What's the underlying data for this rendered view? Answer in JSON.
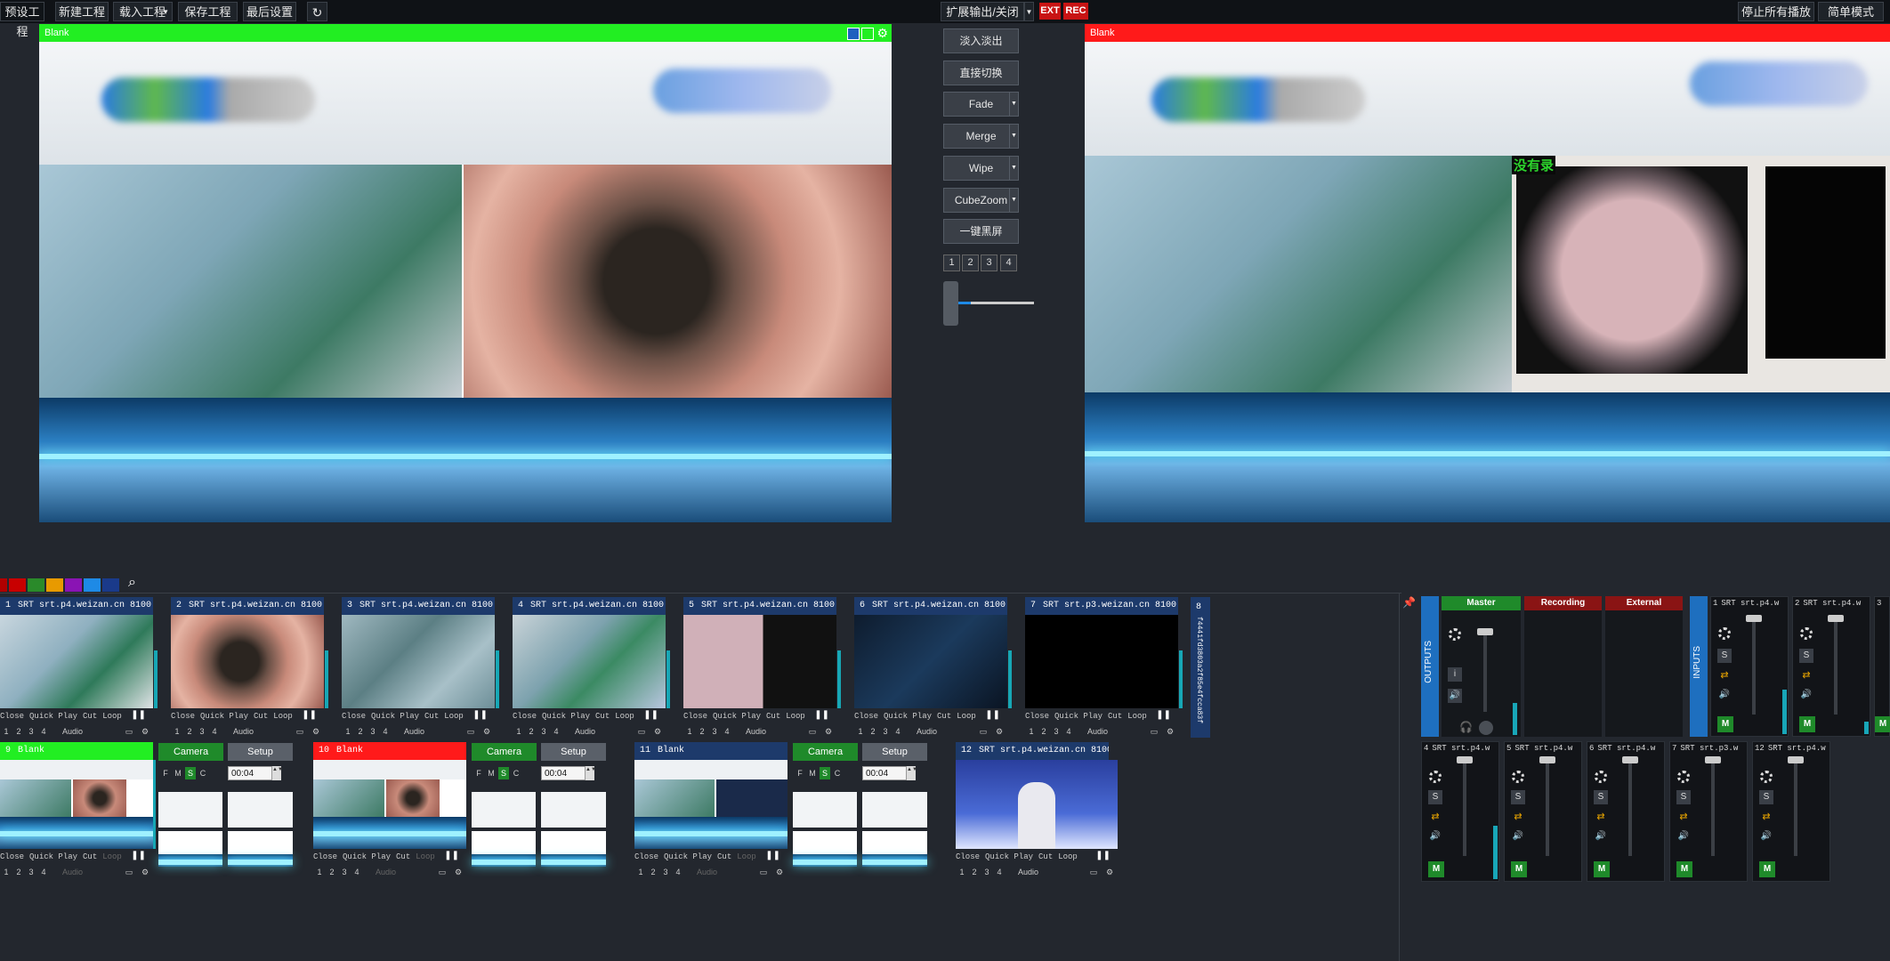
{
  "toolbar": {
    "preset": "预设工程",
    "new_project": "新建工程",
    "load_project": "载入工程",
    "save_project": "保存工程",
    "last_settings": "最后设置",
    "ext_output": "扩展输出/关闭",
    "ext": "EXT",
    "rec": "REC",
    "stop_all": "停止所有播放",
    "simple_mode": "简单模式"
  },
  "preview": {
    "title": "Blank"
  },
  "program": {
    "title": "Blank",
    "overlay_text": "没有录"
  },
  "transitions": {
    "fade_in_out": "淡入淡出",
    "direct_cut": "直接切换",
    "fade": "Fade",
    "merge": "Merge",
    "wipe": "Wipe",
    "cubezoom": "CubeZoom",
    "black_screen": "一键黑屏",
    "pages": [
      "1",
      "2",
      "3",
      "4"
    ],
    "tbar_level": 0.3
  },
  "colors": {
    "preview_bar": "#22ee22",
    "program_bar": "#ff1a1a",
    "input_title": "#1d3a6b",
    "accent_green": "#1f8a2a",
    "swatches": [
      "#c80000",
      "#2a8a2a",
      "#e89a00",
      "#8a14b4",
      "#1e8ae6",
      "#1a3a8a"
    ]
  },
  "inputs_row1": [
    {
      "num": "1",
      "title": "SRT srt.p4.weizan.cn 8100",
      "scene": "or"
    },
    {
      "num": "2",
      "title": "SRT srt.p4.weizan.cn 8100",
      "scene": "eye"
    },
    {
      "num": "3",
      "title": "SRT srt.p4.weizan.cn 8100",
      "scene": "or2"
    },
    {
      "num": "4",
      "title": "SRT srt.p4.weizan.cn 8100",
      "scene": "or3"
    },
    {
      "num": "5",
      "title": "SRT srt.p4.weizan.cn 8100",
      "scene": "fundus"
    },
    {
      "num": "6",
      "title": "SRT srt.p4.weizan.cn 8100",
      "scene": "dark"
    },
    {
      "num": "7",
      "title": "SRT srt.p3.weizan.cn 8100",
      "scene": "black"
    }
  ],
  "input8": {
    "num": "8",
    "vertical_text": "f4441fd3803a2f85e4fcca83f"
  },
  "controls": {
    "close": "Close",
    "quick_play": "Quick Play",
    "cut": "Cut",
    "loop": "Loop",
    "audio": "Audio",
    "nums": [
      "1",
      "2",
      "3",
      "4"
    ]
  },
  "inputs_row2": [
    {
      "num": "9",
      "title": "Blank",
      "bar": "green",
      "camera": "Camera",
      "setup": "Setup",
      "fmsc": [
        "F",
        "M",
        "S",
        "C"
      ],
      "time": "00:04"
    },
    {
      "num": "10",
      "title": "Blank",
      "bar": "red",
      "camera": "Camera",
      "setup": "Setup",
      "fmsc": [
        "F",
        "M",
        "S",
        "C"
      ],
      "time": "00:04"
    },
    {
      "num": "11",
      "title": "Blank",
      "bar": "blue",
      "camera": "Camera",
      "setup": "Setup",
      "fmsc": [
        "F",
        "M",
        "S",
        "C"
      ],
      "time": "00:04"
    },
    {
      "num": "12",
      "title": "SRT srt.p4.weizan.cn 8100",
      "bar": "blue"
    }
  ],
  "mixer": {
    "outputs_label": "OUTPUTS",
    "inputs_label": "INPUTS",
    "master": "Master",
    "recording": "Recording",
    "external": "External",
    "i_label": "i",
    "top_channels": [
      {
        "num": "1",
        "title": "SRT srt.p4.w"
      },
      {
        "num": "2",
        "title": "SRT srt.p4.w"
      },
      {
        "num": "3",
        "title": ""
      }
    ],
    "bottom_channels": [
      {
        "num": "4",
        "title": "SRT srt.p4.w"
      },
      {
        "num": "5",
        "title": "SRT srt.p4.w"
      },
      {
        "num": "6",
        "title": "SRT srt.p4.w"
      },
      {
        "num": "7",
        "title": "SRT srt.p3.w"
      },
      {
        "num": "12",
        "title": "SRT srt.p4.w"
      }
    ],
    "s_label": "S",
    "m_label": "M"
  }
}
